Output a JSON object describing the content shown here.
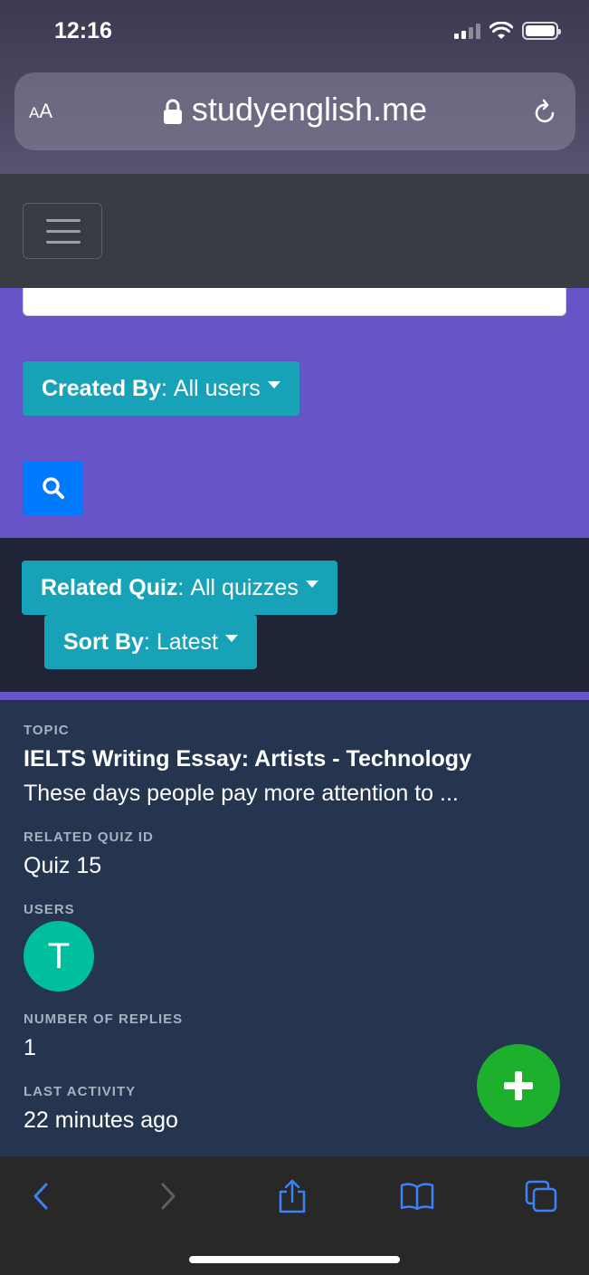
{
  "status_bar": {
    "time": "12:16"
  },
  "browser": {
    "text_size_label_small": "A",
    "text_size_label_large": "A",
    "url": "studyenglish.me"
  },
  "filters": {
    "created_by": {
      "label": "Created By",
      "value": "All users"
    },
    "related_quiz": {
      "label": "Related Quiz",
      "value": "All quizzes"
    },
    "sort_by": {
      "label": "Sort By",
      "value": "Latest"
    }
  },
  "card": {
    "topic_label": "TOPIC",
    "topic_title": "IELTS Writing Essay: Artists - Technology",
    "topic_excerpt": "These days people pay more attention to ...",
    "quiz_label": "RELATED QUIZ ID",
    "quiz_value": "Quiz 15",
    "users_label": "USERS",
    "user_initial": "T",
    "replies_label": "NUMBER OF REPLIES",
    "replies_value": "1",
    "activity_label": "LAST ACTIVITY",
    "activity_value": "22 minutes ago"
  },
  "colors": {
    "purple_band": "#6655c9",
    "teal_pill": "#17a2b8",
    "search_button": "#007bff",
    "card_bg": "#253550",
    "avatar": "#00bf9c",
    "fab": "#1cb02d",
    "safari_tint": "#3b82f6"
  },
  "icons": {
    "lock": "lock-icon",
    "reload": "reload-icon",
    "menu": "hamburger-icon",
    "search": "search-icon",
    "add": "plus-icon",
    "back": "chevron-left-icon",
    "forward": "chevron-right-icon",
    "share": "share-icon",
    "bookmarks": "book-icon",
    "tabs": "tabs-icon"
  }
}
